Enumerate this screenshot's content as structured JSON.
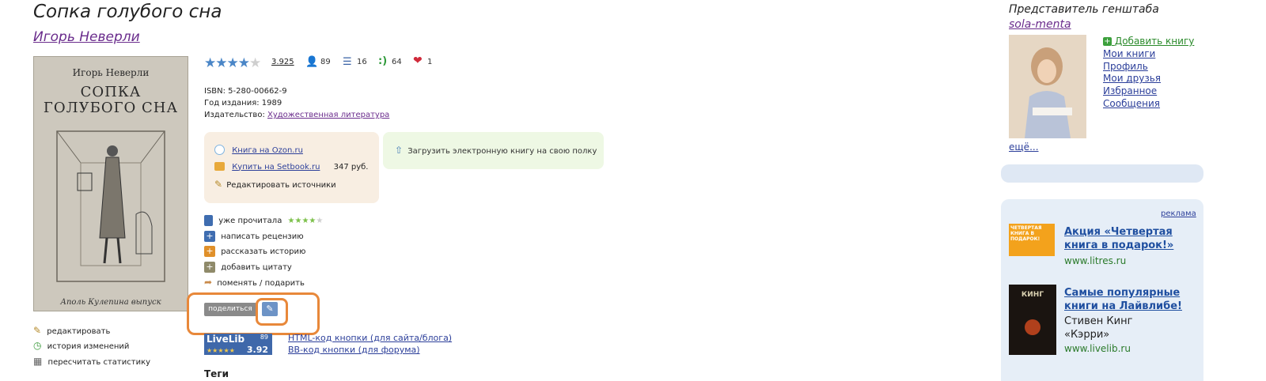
{
  "book": {
    "title": "Сопка голубого сна",
    "author": "Игорь Неверли",
    "cover_author": "Игорь Неверли",
    "cover_title_line1": "СОПКА",
    "cover_title_line2": "ГОЛУБОГО СНА",
    "cover_publisher": "Аполь Кулепина выпуск"
  },
  "stats": {
    "rating_stars": 4,
    "rating_value": "3.925",
    "readers": "89",
    "lists": "16",
    "smiles": "64",
    "likes": "1"
  },
  "info": {
    "isbn": "ISBN: 5-280-00662-9",
    "year": "Год издания: 1989",
    "publisher_label": "Издательство:",
    "publisher_link": "Художественная литература"
  },
  "sources": {
    "ozon": "Книга на Ozon.ru",
    "setbook": "Купить на Setbook.ru",
    "price": "347 руб.",
    "edit": "Редактировать источники",
    "upload": "Загрузить электронную книгу на свою полку"
  },
  "actions": {
    "read": "уже прочитала",
    "read_stars": 4,
    "review": "написать рецензию",
    "story": "рассказать историю",
    "quote": "добавить цитату",
    "swap": "поменять / подарить"
  },
  "share": {
    "label": "поделиться"
  },
  "livelib_badge": {
    "name": "LiveLib",
    "count": "89",
    "score": "3.92",
    "stars": "★★★★★"
  },
  "codes": {
    "html": "HTML-код кнопки (для сайта/блога)",
    "bb": "BB-код кнопки (для форума)"
  },
  "left_tools": {
    "edit": "редактировать",
    "history": "история изменений",
    "recount": "пересчитать статистику"
  },
  "tags_heading": "Теги",
  "right": {
    "representative": "Представитель генштаба",
    "username": "sola-menta",
    "links": [
      "Добавить книгу",
      "Мои книги",
      "Профиль",
      "Мои друзья",
      "Избранное",
      "Сообщения"
    ],
    "more": "ещё..."
  },
  "ads": {
    "label": "реклама",
    "items": [
      {
        "title": "Акция «Четвертая книга в подарок!»",
        "text": "",
        "url": "www.litres.ru",
        "thumb": "ЧЕТВЕРТАЯ КНИГА В ПОДАРОК!"
      },
      {
        "title": "Самые популярные книги на Лайвлибе!",
        "text": "Стивен Кинг «Кэрри»",
        "url": "www.livelib.ru",
        "thumb": "КИНГ"
      }
    ]
  }
}
